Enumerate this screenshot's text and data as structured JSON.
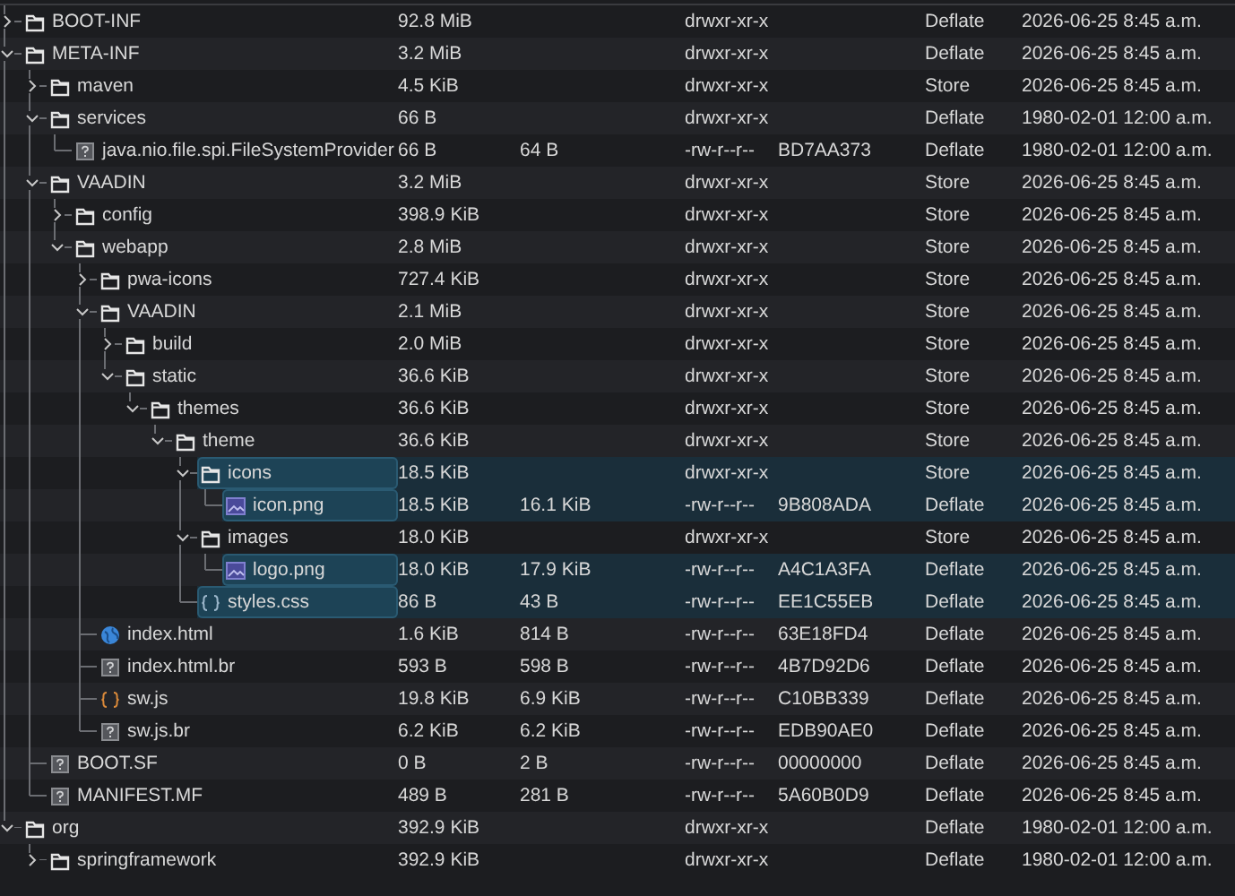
{
  "tree": [
    {
      "name": "BOOT-INF",
      "kind": "folder",
      "expanded": false,
      "selected": false,
      "size": "92.8 MiB",
      "attributes": "drwxr-xr-x",
      "method": "Deflate",
      "modified": "2026-06-25 8:45 a.m."
    },
    {
      "name": "META-INF",
      "kind": "folder",
      "expanded": true,
      "selected": false,
      "size": "3.2 MiB",
      "attributes": "drwxr-xr-x",
      "method": "Deflate",
      "modified": "2026-06-25 8:45 a.m.",
      "children": [
        {
          "name": "maven",
          "kind": "folder",
          "expanded": false,
          "selected": false,
          "size": "4.5 KiB",
          "attributes": "drwxr-xr-x",
          "method": "Store",
          "modified": "2026-06-25 8:45 a.m."
        },
        {
          "name": "services",
          "kind": "folder",
          "expanded": true,
          "selected": false,
          "size": "66 B",
          "attributes": "drwxr-xr-x",
          "method": "Deflate",
          "modified": "1980-02-01 12:00 a.m.",
          "children": [
            {
              "name": "java.nio.file.spi.FileSystemProvider",
              "kind": "file",
              "selected": false,
              "size": "66 B",
              "packed": "64 B",
              "attributes": "-rw-r--r--",
              "crc": "BD7AA373",
              "method": "Deflate",
              "modified": "1980-02-01 12:00 a.m."
            }
          ]
        },
        {
          "name": "VAADIN",
          "kind": "folder",
          "expanded": true,
          "selected": false,
          "size": "3.2 MiB",
          "attributes": "drwxr-xr-x",
          "method": "Store",
          "modified": "2026-06-25 8:45 a.m.",
          "children": [
            {
              "name": "config",
              "kind": "folder",
              "expanded": false,
              "selected": false,
              "size": "398.9 KiB",
              "attributes": "drwxr-xr-x",
              "method": "Store",
              "modified": "2026-06-25 8:45 a.m."
            },
            {
              "name": "webapp",
              "kind": "folder",
              "expanded": true,
              "selected": false,
              "size": "2.8 MiB",
              "attributes": "drwxr-xr-x",
              "method": "Store",
              "modified": "2026-06-25 8:45 a.m.",
              "children": [
                {
                  "name": "pwa-icons",
                  "kind": "folder",
                  "expanded": false,
                  "selected": false,
                  "size": "727.4 KiB",
                  "attributes": "drwxr-xr-x",
                  "method": "Store",
                  "modified": "2026-06-25 8:45 a.m."
                },
                {
                  "name": "VAADIN",
                  "kind": "folder",
                  "expanded": true,
                  "selected": false,
                  "size": "2.1 MiB",
                  "attributes": "drwxr-xr-x",
                  "method": "Store",
                  "modified": "2026-06-25 8:45 a.m.",
                  "children": [
                    {
                      "name": "build",
                      "kind": "folder",
                      "expanded": false,
                      "selected": false,
                      "size": "2.0 MiB",
                      "attributes": "drwxr-xr-x",
                      "method": "Store",
                      "modified": "2026-06-25 8:45 a.m."
                    },
                    {
                      "name": "static",
                      "kind": "folder",
                      "expanded": true,
                      "selected": false,
                      "size": "36.6 KiB",
                      "attributes": "drwxr-xr-x",
                      "method": "Store",
                      "modified": "2026-06-25 8:45 a.m.",
                      "children": [
                        {
                          "name": "themes",
                          "kind": "folder",
                          "expanded": true,
                          "selected": false,
                          "size": "36.6 KiB",
                          "attributes": "drwxr-xr-x",
                          "method": "Store",
                          "modified": "2026-06-25 8:45 a.m.",
                          "children": [
                            {
                              "name": "theme",
                              "kind": "folder",
                              "expanded": true,
                              "selected": false,
                              "size": "36.6 KiB",
                              "attributes": "drwxr-xr-x",
                              "method": "Store",
                              "modified": "2026-06-25 8:45 a.m.",
                              "children": [
                                {
                                  "name": "icons",
                                  "kind": "folder",
                                  "expanded": true,
                                  "selected": true,
                                  "size": "18.5 KiB",
                                  "attributes": "drwxr-xr-x",
                                  "method": "Store",
                                  "modified": "2026-06-25 8:45 a.m.",
                                  "children": [
                                    {
                                      "name": "icon.png",
                                      "kind": "image",
                                      "selected": true,
                                      "size": "18.5 KiB",
                                      "packed": "16.1 KiB",
                                      "attributes": "-rw-r--r--",
                                      "crc": "9B808ADA",
                                      "method": "Deflate",
                                      "modified": "2026-06-25 8:45 a.m."
                                    }
                                  ]
                                },
                                {
                                  "name": "images",
                                  "kind": "folder",
                                  "expanded": true,
                                  "selected": false,
                                  "size": "18.0 KiB",
                                  "attributes": "drwxr-xr-x",
                                  "method": "Store",
                                  "modified": "2026-06-25 8:45 a.m.",
                                  "children": [
                                    {
                                      "name": "logo.png",
                                      "kind": "image",
                                      "selected": true,
                                      "size": "18.0 KiB",
                                      "packed": "17.9 KiB",
                                      "attributes": "-rw-r--r--",
                                      "crc": "A4C1A3FA",
                                      "method": "Deflate",
                                      "modified": "2026-06-25 8:45 a.m."
                                    }
                                  ]
                                },
                                {
                                  "name": "styles.css",
                                  "kind": "css",
                                  "selected": true,
                                  "size": "86 B",
                                  "packed": "43 B",
                                  "attributes": "-rw-r--r--",
                                  "crc": "EE1C55EB",
                                  "method": "Deflate",
                                  "modified": "2026-06-25 8:45 a.m."
                                }
                              ]
                            }
                          ]
                        }
                      ]
                    }
                  ]
                },
                {
                  "name": "index.html",
                  "kind": "web",
                  "selected": false,
                  "size": "1.6 KiB",
                  "packed": "814 B",
                  "attributes": "-rw-r--r--",
                  "crc": "63E18FD4",
                  "method": "Deflate",
                  "modified": "2026-06-25 8:45 a.m."
                },
                {
                  "name": "index.html.br",
                  "kind": "file",
                  "selected": false,
                  "size": "593 B",
                  "packed": "598 B",
                  "attributes": "-rw-r--r--",
                  "crc": "4B7D92D6",
                  "method": "Deflate",
                  "modified": "2026-06-25 8:45 a.m."
                },
                {
                  "name": "sw.js",
                  "kind": "script",
                  "selected": false,
                  "size": "19.8 KiB",
                  "packed": "6.9 KiB",
                  "attributes": "-rw-r--r--",
                  "crc": "C10BB339",
                  "method": "Deflate",
                  "modified": "2026-06-25 8:45 a.m."
                },
                {
                  "name": "sw.js.br",
                  "kind": "file",
                  "selected": false,
                  "size": "6.2 KiB",
                  "packed": "6.2 KiB",
                  "attributes": "-rw-r--r--",
                  "crc": "EDB90AE0",
                  "method": "Deflate",
                  "modified": "2026-06-25 8:45 a.m."
                }
              ]
            }
          ]
        },
        {
          "name": "BOOT.SF",
          "kind": "file",
          "selected": false,
          "size": "0 B",
          "packed": "2 B",
          "attributes": "-rw-r--r--",
          "crc": "00000000",
          "method": "Deflate",
          "modified": "2026-06-25 8:45 a.m."
        },
        {
          "name": "MANIFEST.MF",
          "kind": "file",
          "selected": false,
          "size": "489 B",
          "packed": "281 B",
          "attributes": "-rw-r--r--",
          "crc": "5A60B0D9",
          "method": "Deflate",
          "modified": "2026-06-25 8:45 a.m."
        }
      ]
    },
    {
      "name": "org",
      "kind": "folder",
      "expanded": true,
      "selected": false,
      "size": "392.9 KiB",
      "attributes": "drwxr-xr-x",
      "method": "Deflate",
      "modified": "1980-02-01 12:00 a.m.",
      "children": [
        {
          "name": "springframework",
          "kind": "folder",
          "expanded": false,
          "selected": false,
          "size": "392.9 KiB",
          "attributes": "drwxr-xr-x",
          "method": "Deflate",
          "modified": "1980-02-01 12:00 a.m."
        }
      ]
    }
  ]
}
